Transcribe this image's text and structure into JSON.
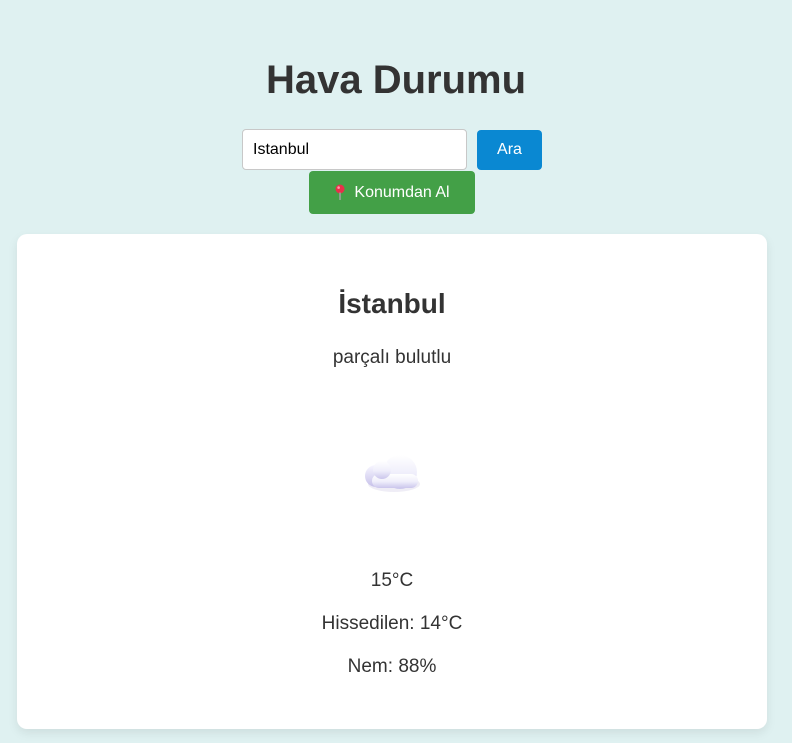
{
  "header": {
    "title": "Hava Durumu"
  },
  "search": {
    "value": "Istanbul",
    "button_label": "Ara",
    "location_button_label": "Konumdan Al",
    "location_icon": "pin-icon"
  },
  "weather": {
    "city": "İstanbul",
    "description": "parçalı bulutlu",
    "icon": "cloud-icon",
    "temperature": "15°C",
    "feels_like": "Hissedilen: 14°C",
    "humidity": "Nem: 88%"
  },
  "colors": {
    "background": "#dff1f1",
    "search_button": "#0a88d2",
    "location_button": "#43a047",
    "card": "#ffffff",
    "text": "#333333"
  }
}
